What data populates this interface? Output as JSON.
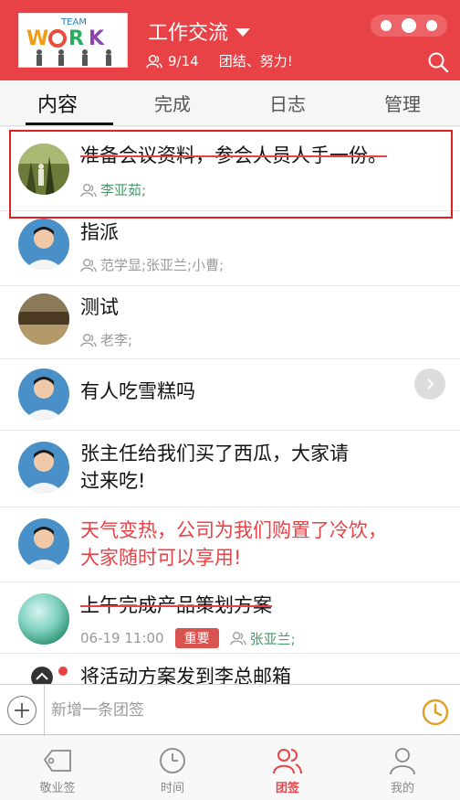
{
  "header": {
    "logo_text": "TEAM WORK",
    "title": "工作交流",
    "member_count": "9/14",
    "motto": "团结、努力!"
  },
  "tabs": [
    {
      "label": "内容",
      "active": true
    },
    {
      "label": "完成",
      "active": false
    },
    {
      "label": "日志",
      "active": false
    },
    {
      "label": "管理",
      "active": false
    }
  ],
  "items": [
    {
      "text": "准备会议资料，参会人员人手一份。",
      "status": "done",
      "assignees": "李亚茹;",
      "avatar": "forest-photo"
    },
    {
      "text": "指派",
      "status": "open",
      "assignees": "范学显;张亚兰;小曹;",
      "avatar": "man-portrait"
    },
    {
      "text": "测试",
      "status": "open",
      "assignees": "老李;",
      "avatar": "wall-photo"
    },
    {
      "text": "有人吃雪糕吗",
      "status": "open",
      "assignees": "",
      "avatar": "man-portrait"
    },
    {
      "text_line1": "张主任给我们买了西瓜，大家请",
      "text_line2": "过来吃!",
      "status": "open",
      "avatar": "man-portrait"
    },
    {
      "text_line1": "天气变热，公司为我们购置了冷饮，",
      "text_line2": "大家随时可以享用!",
      "status": "important-red",
      "avatar": "man-portrait"
    },
    {
      "text": "上午完成产品策划方案",
      "status": "done",
      "datetime": "06-19 11:00",
      "badge": "重要",
      "assignees": "张亚兰;",
      "avatar": "green-ball"
    },
    {
      "text": "将活动方案发到李总邮箱",
      "status": "open",
      "avatar": "dark-icon"
    }
  ],
  "inputbar": {
    "placeholder": "新增一条团签"
  },
  "bottomnav": [
    {
      "label": "敬业签",
      "icon": "tag-icon",
      "active": false
    },
    {
      "label": "时间",
      "icon": "clock-icon",
      "active": false
    },
    {
      "label": "团签",
      "icon": "group-icon",
      "active": true
    },
    {
      "label": "我的",
      "icon": "person-icon",
      "active": false
    }
  ],
  "colors": {
    "brand": "#e84247",
    "highlight_border": "#e02020",
    "assignee_green": "#4a9a6a",
    "badge": "#d9534f"
  }
}
